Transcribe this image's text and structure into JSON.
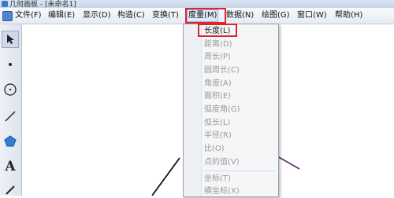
{
  "window": {
    "title": "几何画板 - [未命名1]"
  },
  "menubar": {
    "items": [
      {
        "label": "文件(F)"
      },
      {
        "label": "编辑(E)"
      },
      {
        "label": "显示(D)"
      },
      {
        "label": "构造(C)"
      },
      {
        "label": "变换(T)"
      },
      {
        "label": "度量(M)"
      },
      {
        "label": "数据(N)"
      },
      {
        "label": "绘图(G)"
      },
      {
        "label": "窗口(W)"
      },
      {
        "label": "帮助(H)"
      }
    ],
    "active": "度量(M)"
  },
  "toolbar": {
    "tools": [
      "select-arrow-icon",
      "point-icon",
      "compass-circle-icon",
      "straightedge-icon",
      "polygon-icon",
      "text-icon",
      "marker-icon"
    ],
    "text_tool_label": "A"
  },
  "measure_menu": {
    "items": [
      {
        "label": "长度(L)",
        "enabled": true
      },
      {
        "label": "距离(D)",
        "enabled": false
      },
      {
        "label": "周长(P)",
        "enabled": false
      },
      {
        "label": "圆周长(C)",
        "enabled": false
      },
      {
        "label": "角度(A)",
        "enabled": false
      },
      {
        "label": "面积(E)",
        "enabled": false
      },
      {
        "label": "弧度角(G)",
        "enabled": false
      },
      {
        "label": "弧长(L)",
        "enabled": false
      },
      {
        "label": "半径(R)",
        "enabled": false
      },
      {
        "label": "比(O)",
        "enabled": false
      },
      {
        "label": "点的值(V)",
        "enabled": false
      },
      {
        "label": "坐标(T)",
        "enabled": false
      },
      {
        "label": "横坐标(X)",
        "enabled": false
      }
    ]
  },
  "colors": {
    "highlight": "#e0232d",
    "segment_black": "#111111",
    "segment_purple": "#6a2a7a"
  }
}
